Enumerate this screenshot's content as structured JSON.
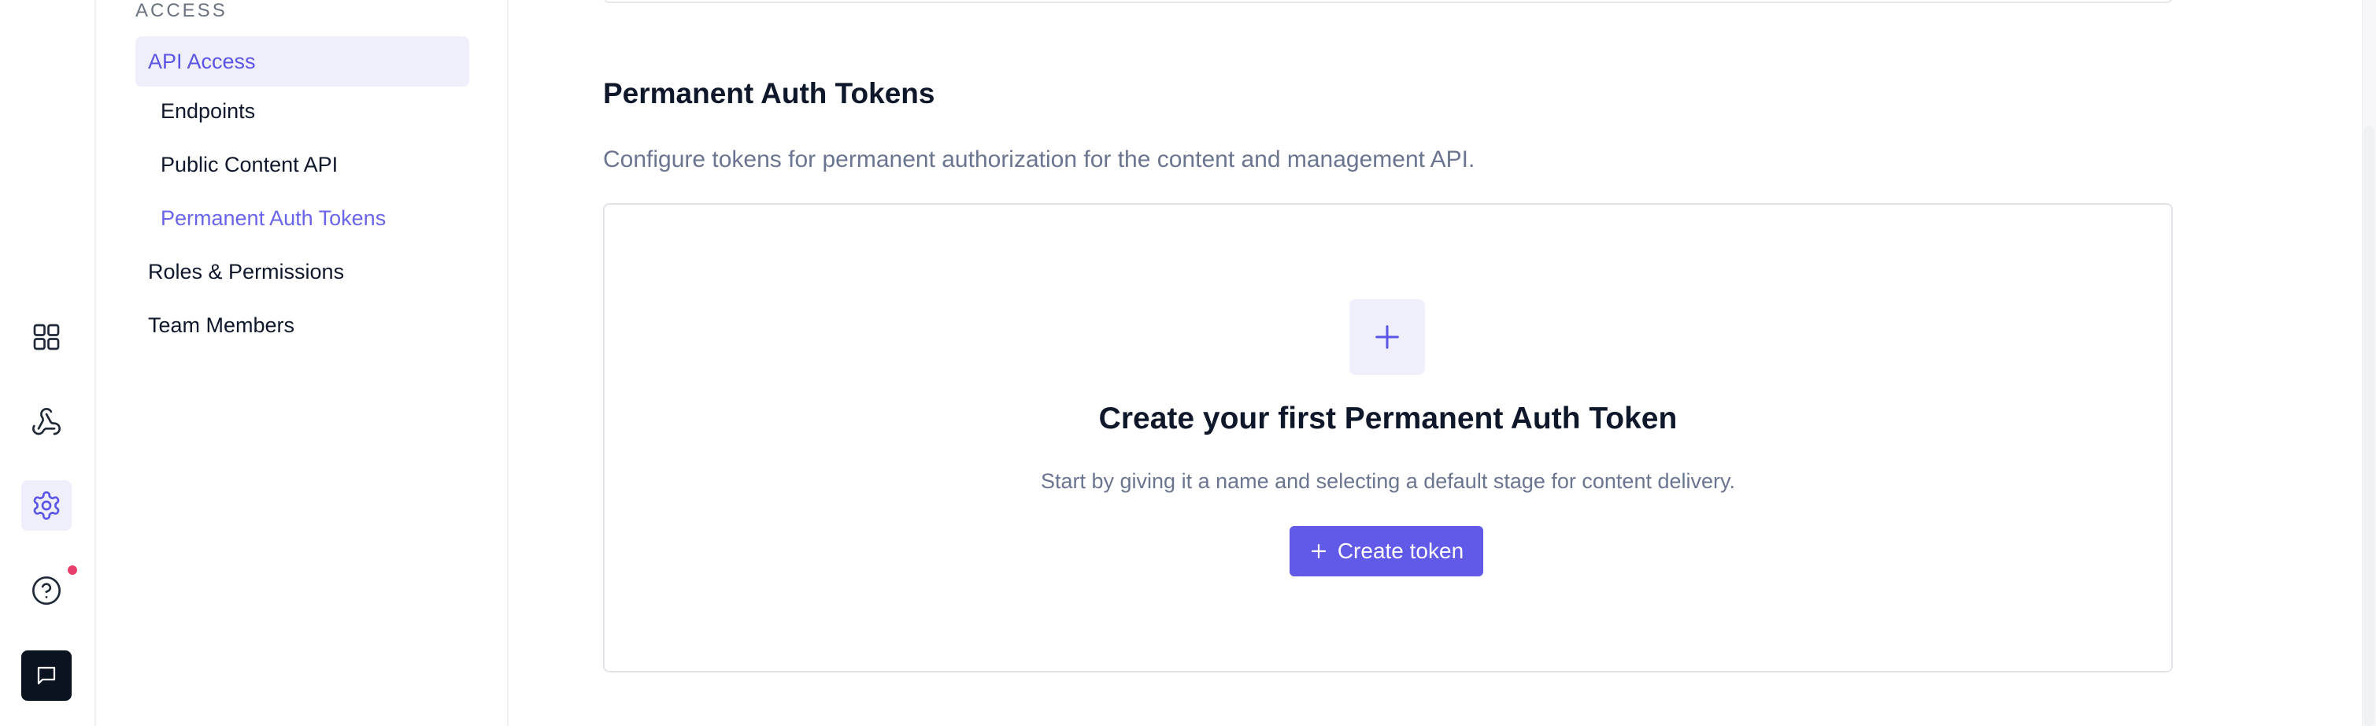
{
  "rail": {
    "icons": [
      "apps-grid-icon",
      "webhooks-icon",
      "settings-gear-icon",
      "help-icon",
      "chat-icon"
    ],
    "notification_color": "#e63e6d"
  },
  "subnav": {
    "section_label": "ACCESS",
    "items": [
      {
        "label": "API Access"
      },
      {
        "label": "Endpoints"
      },
      {
        "label": "Public Content API"
      },
      {
        "label": "Permanent Auth Tokens"
      },
      {
        "label": "Roles & Permissions"
      },
      {
        "label": "Team Members"
      }
    ]
  },
  "main": {
    "title": "Permanent Auth Tokens",
    "description": "Configure tokens for permanent authorization for the content and management API.",
    "empty_state": {
      "title": "Create your first Permanent Auth Token",
      "description": "Start by giving it a name and selecting a default stage for content delivery.",
      "button_label": "Create token"
    }
  },
  "colors": {
    "accent": "#6159e8",
    "active_bg": "#efeefb",
    "muted_text": "#6b7590"
  }
}
